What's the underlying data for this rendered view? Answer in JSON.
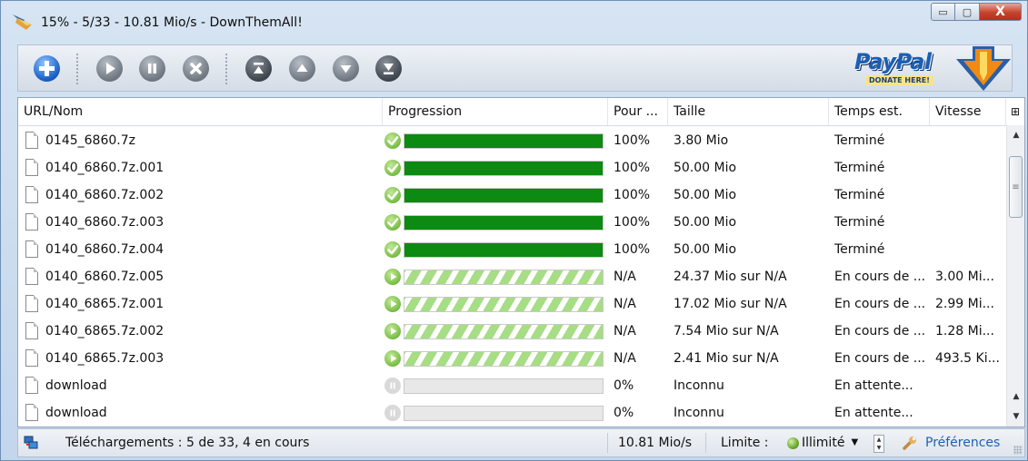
{
  "window": {
    "title": "15% - 5/33 - 10.81 Mio/s - DownThemAll!",
    "controls": {
      "minimize": "▭",
      "maximize": "▢",
      "close": "X"
    }
  },
  "toolbar": {
    "buttons": [
      "add-icon",
      "resume-icon",
      "pause-icon",
      "cancel-icon",
      "move-top-icon",
      "move-up-icon",
      "move-down-icon",
      "move-bottom-icon"
    ],
    "paypal": {
      "logo": "PayPal",
      "tagline": "DONATE HERE!"
    }
  },
  "columns": {
    "name": "URL/Nom",
    "progress": "Progression",
    "percent": "Pour ...",
    "size": "Taille",
    "eta": "Temps est.",
    "speed": "Vitesse",
    "picker": "⊞"
  },
  "downloads": [
    {
      "name": "0145_6860.7z",
      "state": "done",
      "progress": 1.0,
      "percent": "100%",
      "size": "3.80 Mio",
      "eta": "Terminé",
      "speed": ""
    },
    {
      "name": "0140_6860.7z.001",
      "state": "done",
      "progress": 1.0,
      "percent": "100%",
      "size": "50.00 Mio",
      "eta": "Terminé",
      "speed": ""
    },
    {
      "name": "0140_6860.7z.002",
      "state": "done",
      "progress": 1.0,
      "percent": "100%",
      "size": "50.00 Mio",
      "eta": "Terminé",
      "speed": ""
    },
    {
      "name": "0140_6860.7z.003",
      "state": "done",
      "progress": 1.0,
      "percent": "100%",
      "size": "50.00 Mio",
      "eta": "Terminé",
      "speed": ""
    },
    {
      "name": "0140_6860.7z.004",
      "state": "done",
      "progress": 1.0,
      "percent": "100%",
      "size": "50.00 Mio",
      "eta": "Terminé",
      "speed": ""
    },
    {
      "name": "0140_6860.7z.005",
      "state": "running",
      "progress": 1.0,
      "percent": "N/A",
      "size": "24.37 Mio sur N/A",
      "eta": "En cours de ...",
      "speed": "3.00 Mi..."
    },
    {
      "name": "0140_6865.7z.001",
      "state": "running",
      "progress": 1.0,
      "percent": "N/A",
      "size": "17.02 Mio sur N/A",
      "eta": "En cours de ...",
      "speed": "2.99 Mi..."
    },
    {
      "name": "0140_6865.7z.002",
      "state": "running",
      "progress": 1.0,
      "percent": "N/A",
      "size": "7.54 Mio sur N/A",
      "eta": "En cours de ...",
      "speed": "1.28 Mi..."
    },
    {
      "name": "0140_6865.7z.003",
      "state": "running",
      "progress": 1.0,
      "percent": "N/A",
      "size": "2.41 Mio sur N/A",
      "eta": "En cours de ...",
      "speed": "493.5 Ki..."
    },
    {
      "name": "download",
      "state": "queued",
      "progress": 0.0,
      "percent": "0%",
      "size": "Inconnu",
      "eta": "En attente...",
      "speed": ""
    },
    {
      "name": "download",
      "state": "queued",
      "progress": 0.0,
      "percent": "0%",
      "size": "Inconnu",
      "eta": "En attente...",
      "speed": ""
    }
  ],
  "statusbar": {
    "summary": "Téléchargements : 5 de 33, 4 en cours",
    "speed": "10.81 Mio/s",
    "limit_label": "Limite :",
    "limit_value": "Illimité",
    "preferences": "Préférences"
  },
  "colors": {
    "done_bar": "#0c8a12",
    "running_stripe": "#a6dd85",
    "status_done": "#7cc04a",
    "status_queued": "#d9d9d9",
    "link": "#1f5fb8"
  }
}
